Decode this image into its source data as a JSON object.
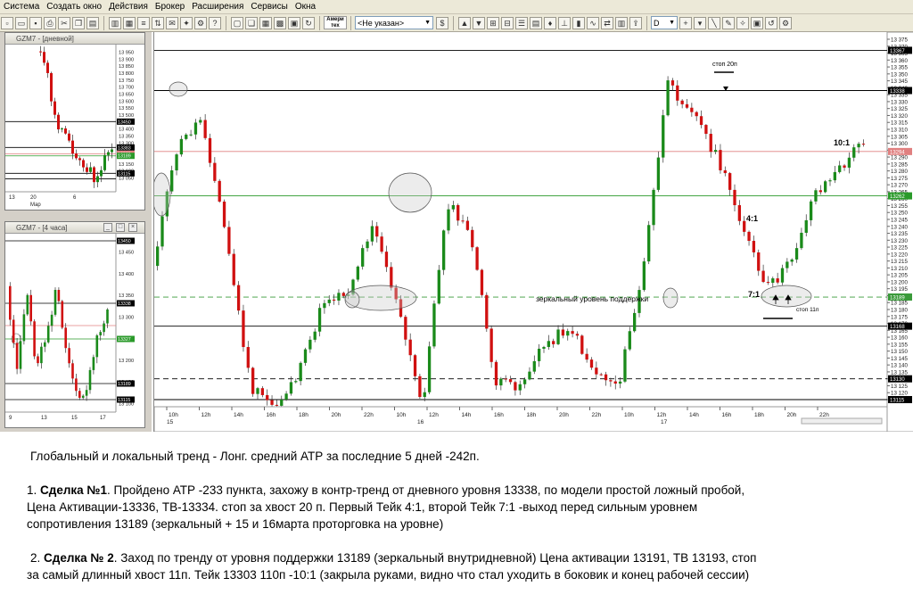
{
  "menu": [
    "Система",
    "Создать окно",
    "Действия",
    "Брокер",
    "Расширения",
    "Сервисы",
    "Окна"
  ],
  "toolbar": {
    "broker_logo": "Амери тех",
    "account_value": "<Не указан>",
    "period_value": "D"
  },
  "mini1": {
    "title": "GZM7 - [дневной]",
    "price_ticks": [
      "13 950",
      "13 900",
      "13 850",
      "13 800",
      "13 750",
      "13 700",
      "13 650",
      "13 600",
      "13 550",
      "13 500",
      "13 450",
      "13 400",
      "13 350",
      "13 300",
      "13 250",
      "13 200",
      "13 150",
      "13 100",
      "13 050"
    ],
    "level_tags": [
      "13450",
      "13383",
      "13339",
      "13189",
      "13115"
    ],
    "x_ticks": [
      "13",
      "20",
      "6"
    ],
    "x_sub": "Мар"
  },
  "mini2": {
    "title": "GZM7 - [4 часа]",
    "price_ticks": [
      "13 450",
      "13 400",
      "13 350",
      "13 300",
      "13 250",
      "13 200",
      "13 150",
      "13 100"
    ],
    "level_tags": [
      "13450",
      "13338",
      "13327",
      "13189",
      "13115"
    ],
    "x_ticks": [
      "9",
      "13",
      "15",
      "17"
    ]
  },
  "main": {
    "price_ticks": [
      "13 375",
      "13 370",
      "13 365",
      "13 360",
      "13 355",
      "13 350",
      "13 345",
      "13 340",
      "13 335",
      "13 330",
      "13 325",
      "13 320",
      "13 315",
      "13 310",
      "13 305",
      "13 300",
      "13 295",
      "13 290",
      "13 285",
      "13 280",
      "13 275",
      "13 270",
      "13 265",
      "13 260",
      "13 255",
      "13 250",
      "13 245",
      "13 240",
      "13 235",
      "13 230",
      "13 225",
      "13 220",
      "13 215",
      "13 210",
      "13 205",
      "13 200",
      "13 195",
      "13 190",
      "13 185",
      "13 180",
      "13 175",
      "13 170",
      "13 165",
      "13 160",
      "13 155",
      "13 150",
      "13 145",
      "13 140",
      "13 135",
      "13 130",
      "13 125",
      "13 120",
      "13 115"
    ],
    "level_tags": [
      "13367",
      "13338",
      "13294",
      "13262",
      "13189",
      "13168",
      "13130",
      "13115"
    ],
    "time_ticks": [
      "10h",
      "12h",
      "14h",
      "16h",
      "18h",
      "20h",
      "22h",
      "10h",
      "12h",
      "14h",
      "16h",
      "18h",
      "20h",
      "22h",
      "10h",
      "12h",
      "14h",
      "16h",
      "18h",
      "20h",
      "22h"
    ],
    "date_labels": [
      "15",
      "16",
      "17"
    ],
    "annotations": {
      "stop20": "стоп 20п",
      "stop11": "стоп 11п",
      "r10": "10:1",
      "r4": "4:1",
      "r7": "7:1",
      "mirror": "зеркальный уровень поддержки"
    }
  },
  "notes": {
    "line1": "Глобальный и локальный тренд - Лонг. средний АТР за последние 5 дней -242п.",
    "deal1_prefix": "1. ",
    "deal1_title": "Сделка №1",
    "deal1_text_a": ".  Пройдено АТР -233 пункта, захожу в контр-тренд от дневного уровня  13338, по модели простой ложный пробой,",
    "deal1_text_b": "Цена Активации-13336, ТВ-13334. стоп за хвост 20 п.  Первый  Тейк  4:1, второй  Тейк 7:1 -выход перед  сильным уровнем",
    "deal1_text_c": "сопротивления 13189 (зеркальный + 15 и 16марта  проторговка на уровне)",
    "deal2_prefix": "2. ",
    "deal2_title": "Сделка № 2",
    "deal2_text_a": ". Заход по тренду от уровня поддержки 13189 (зеркальный внутридневной) Цена активации 13191, ТВ 13193, стоп",
    "deal2_text_b": "за самый длинный хвост 11п. Тейк 13303 110п -10:1 (закрыла руками, видно что  стал уходить в боковик и конец рабочей сессии)"
  },
  "colors": {
    "up": "#1a8a1a",
    "down": "#d01010",
    "green_level": "#2a9a2a",
    "pink_level": "#e08080"
  }
}
